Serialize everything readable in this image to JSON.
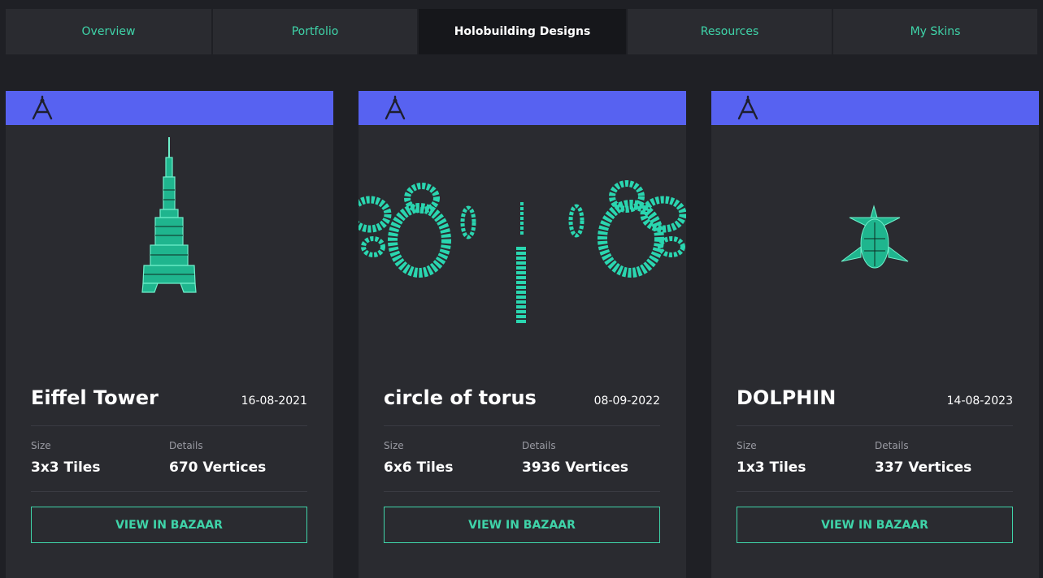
{
  "tabs": [
    {
      "label": "Overview",
      "active": false
    },
    {
      "label": "Portfolio",
      "active": false
    },
    {
      "label": "Holobuilding Designs",
      "active": true
    },
    {
      "label": "Resources",
      "active": false
    },
    {
      "label": "My Skins",
      "active": false
    }
  ],
  "colors": {
    "accent": "#3fd4a9",
    "header": "#5762f1",
    "card": "#2a2b30",
    "background": "#1f2025"
  },
  "cards": [
    {
      "title": "Eiffel Tower",
      "date": "16-08-2021",
      "size_label": "Size",
      "size_value": "3x3 Tiles",
      "details_label": "Details",
      "details_value": "670 Vertices",
      "button": "VIEW IN BAZAAR",
      "icon": "compass-icon",
      "preview": "eiffel-tower-model"
    },
    {
      "title": "circle of torus",
      "date": "08-09-2022",
      "size_label": "Size",
      "size_value": "6x6 Tiles",
      "details_label": "Details",
      "details_value": "3936 Vertices",
      "button": "VIEW IN BAZAAR",
      "icon": "compass-icon",
      "preview": "torus-circle-model"
    },
    {
      "title": "DOLPHIN",
      "date": "14-08-2023",
      "size_label": "Size",
      "size_value": "1x3 Tiles",
      "details_label": "Details",
      "details_value": "337 Vertices",
      "button": "VIEW IN BAZAAR",
      "icon": "compass-icon",
      "preview": "dolphin-model"
    }
  ]
}
